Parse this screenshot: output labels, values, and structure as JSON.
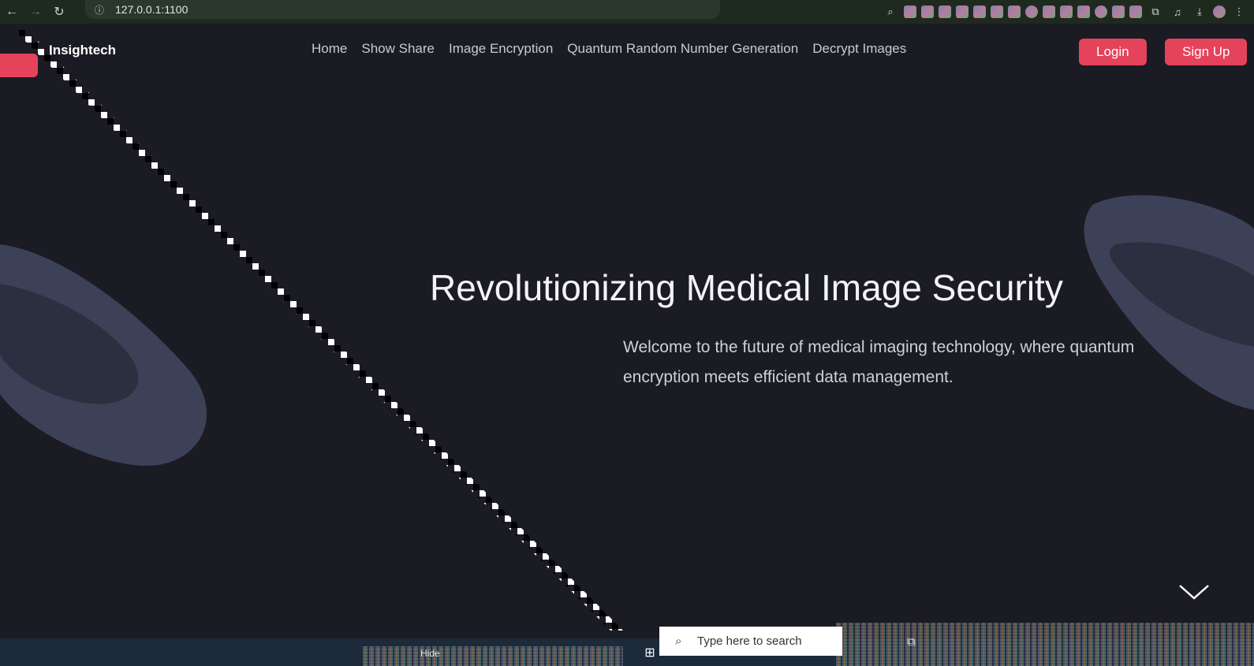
{
  "browser": {
    "url": "127.0.0.1:1100",
    "back_icon": "back-arrow-icon",
    "forward_icon": "forward-arrow-icon",
    "reload_icon": "reload-icon",
    "zoom_icon": "zoom-icon",
    "extensions_icon": "puzzle-icon",
    "downloads_icon": "download-icon",
    "menu_icon": "kebab-menu-icon"
  },
  "site": {
    "logo": "Insightech",
    "nav": [
      "Home",
      "Show Share",
      "Image Encryption",
      "Quantum Random Number Generation",
      "Decrypt Images"
    ],
    "login_label": "Login",
    "signup_label": "Sign Up"
  },
  "hero": {
    "title": "Revolutionizing Medical Image Security",
    "subtitle": "Welcome to the future of medical imaging technology, where quantum encryption meets efficient data management."
  },
  "taskbar": {
    "search_placeholder": "Type here to search",
    "tray_label": "Hide"
  },
  "colors": {
    "page_bg": "#1b1b24",
    "accent": "#e5435c",
    "browser_bar": "#1f2a1f",
    "taskbar": "#1c2a3a"
  }
}
